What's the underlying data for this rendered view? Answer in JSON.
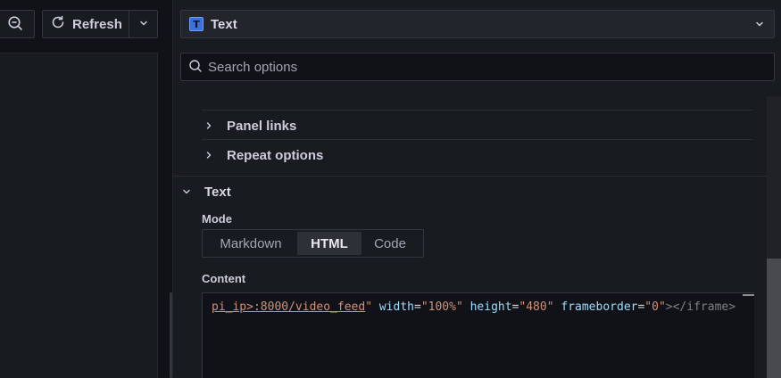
{
  "toolbar": {
    "zoom_icon": "zoom-out-icon",
    "refresh_label": "Refresh",
    "refresh_icon": "refresh-icon",
    "caret_icon": "chevron-down-icon"
  },
  "visualization": {
    "icon": "text-panel-icon",
    "icon_glyph": "T",
    "name": "Text"
  },
  "search": {
    "placeholder": "Search options"
  },
  "option_groups": [
    {
      "label": "Panel links",
      "expanded": false
    },
    {
      "label": "Repeat options",
      "expanded": false
    }
  ],
  "text_section": {
    "title": "Text",
    "expanded": true,
    "mode_label": "Mode",
    "modes": [
      "Markdown",
      "HTML",
      "Code"
    ],
    "active_mode": "HTML",
    "content_label": "Content",
    "code": {
      "url_part": "pi_ip>:8000/video_feed",
      "quote1": "\"",
      "attr_width": "width",
      "eq1": "=",
      "val_width": "\"100%\"",
      "attr_height": "height",
      "eq2": "=",
      "val_height": "\"480\"",
      "attr_frameborder": "frameborder",
      "eq3": "=",
      "val_frameborder": "\"0\"",
      "closing": "></iframe>"
    }
  },
  "colors": {
    "background": "#111217",
    "panel": "#181b1f",
    "border": "#34363d",
    "accent": "#3d71d9"
  }
}
